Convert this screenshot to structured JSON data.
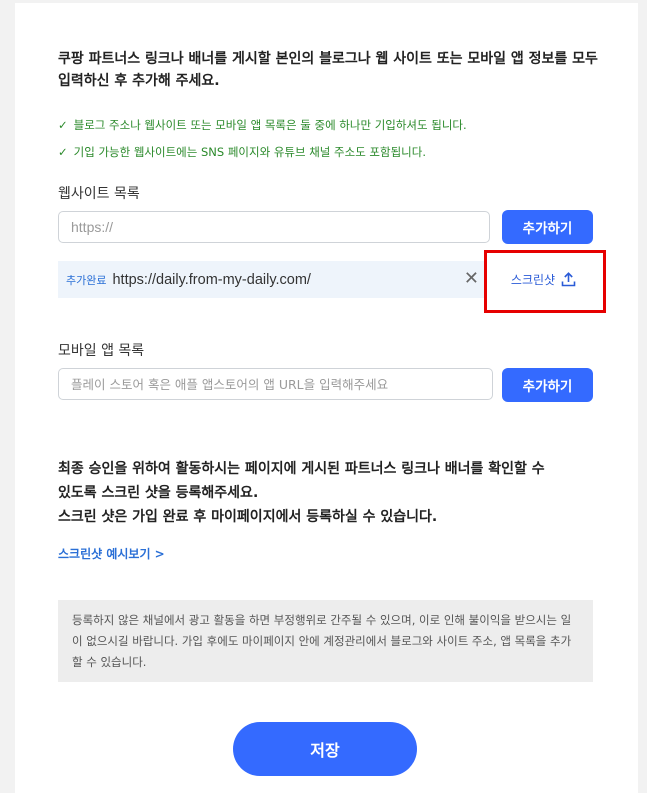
{
  "intro": "쿠팡 파트너스 링크나 배너를 게시할 본인의 블로그나 웹 사이트 또는 모바일 앱 정보를 모두 입력하신 후 추가해 주세요.",
  "checks": [
    "블로그 주소나 웹사이트 또는 모바일 앱 목록은 둘 중에 하나만 기입하셔도 됩니다.",
    "기입 가능한 웹사이트에는 SNS 페이지와 유튜브 채널 주소도 포함됩니다."
  ],
  "check_mark": "✓",
  "website": {
    "label": "웹사이트 목록",
    "input_placeholder": "https://",
    "input_value": "",
    "add_label": "추가하기",
    "added_items": [
      {
        "tag": "추가완료",
        "url": "https://daily.from-my-daily.com/",
        "screenshot_label": "스크린샷",
        "screenshot_icon": "upload-icon",
        "remove_icon": "close-icon"
      }
    ]
  },
  "mobile": {
    "label": "모바일 앱 목록",
    "input_placeholder": "플레이 스토어 혹은 애플 앱스토어의 앱 URL을 입력해주세요",
    "input_value": "",
    "add_label": "추가하기"
  },
  "approval": {
    "line1": "최종 승인을 위하여 활동하시는 페이지에 게시된 파트너스 링크나 배너를 확인할 수",
    "line2": "있도록 스크린 샷을 등록해주세요.",
    "line3": "스크린 샷은 가입 완료 후 마이페이지에서 등록하실 수 있습니다."
  },
  "preview_link": "스크린샷 예시보기 >",
  "notice": "등록하지 않은 채널에서 광고 활동을 하면 부정행위로 간주될 수 있으며, 이로 인해 불이익을 받으시는 일이 없으시길 바랍니다. 가입 후에도 마이페이지 안에 계정관리에서 블로그와 사이트 주소, 앱 목록을 추가할 수 있습니다.",
  "save_label": "저장",
  "colors": {
    "primary": "#346aff",
    "check_green": "#2b8a2b",
    "highlight_red": "#e60000",
    "added_bg": "#eef4fb"
  }
}
